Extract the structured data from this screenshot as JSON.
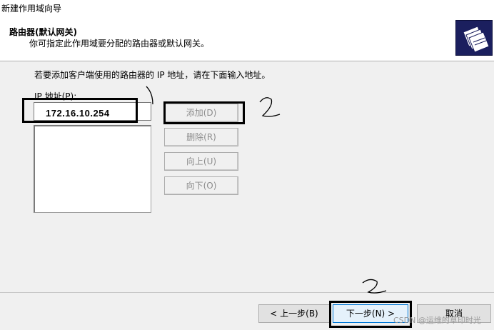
{
  "window": {
    "title": "新建作用域向导"
  },
  "header": {
    "title": "路由器(默认网关)",
    "subtitle": "你可指定此作用域要分配的路由器或默认网关。",
    "icon": "folder-stack-icon"
  },
  "main": {
    "instruction": "若要添加客户端使用的路由器的 IP 地址，请在下面输入地址。",
    "ip_label": "IP 地址(P):",
    "ip_value": "172.16.10.254",
    "buttons": {
      "add": "添加(D)",
      "remove": "删除(R)",
      "up": "向上(U)",
      "down": "向下(O)"
    }
  },
  "footer": {
    "back": "< 上一步(B)",
    "next": "下一步(N) >",
    "cancel": "取消"
  },
  "annotations": {
    "mark_1": "1",
    "mark_2": "2"
  },
  "watermark": "CSDN @运维的草印时光"
}
